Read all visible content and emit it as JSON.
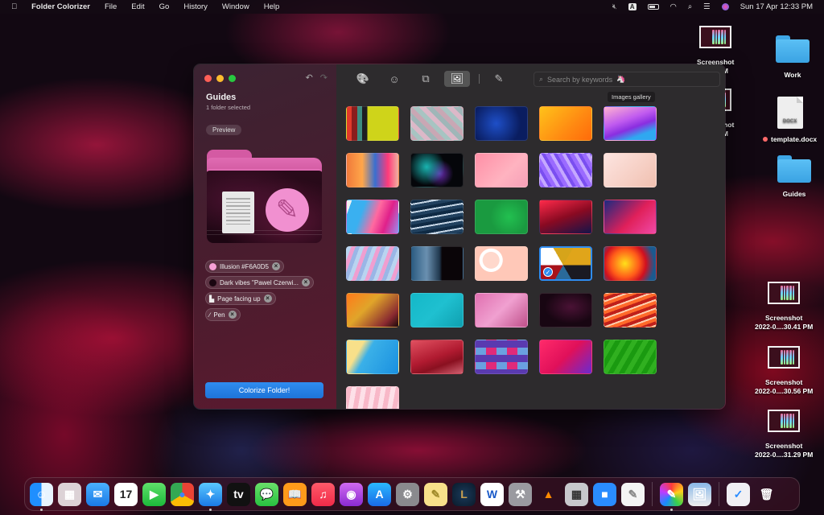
{
  "menubar": {
    "app_name": "Folder Colorizer",
    "menus": [
      "File",
      "Edit",
      "Go",
      "History",
      "Window",
      "Help"
    ],
    "input_source": "A",
    "datetime": "Sun 17 Apr  12:33 PM",
    "status_icons": [
      "mute-icon",
      "input-source-icon",
      "battery-icon",
      "wifi-icon",
      "spotlight-icon",
      "control-center-icon",
      "siri-icon"
    ]
  },
  "desktop": {
    "items": [
      {
        "label1": "Screenshot",
        "label2": "...10 PM",
        "kind": "screenshot"
      },
      {
        "label1": "Screenshot",
        "label2": "...31 PM",
        "kind": "screenshot"
      },
      {
        "label1": "Work",
        "kind": "folder"
      },
      {
        "label1": "template.docx",
        "kind": "docx",
        "file_type": "DOCX",
        "tag_color": "#FF6A6A"
      },
      {
        "label1": "Guides",
        "kind": "folder"
      },
      {
        "label1": "Screenshot",
        "label2": "2022-0....30.41 PM",
        "kind": "screenshot"
      },
      {
        "label1": "Screenshot",
        "label2": "2022-0....30.56 PM",
        "kind": "screenshot"
      },
      {
        "label1": "Screenshot",
        "label2": "2022-0....31.29 PM",
        "kind": "screenshot"
      }
    ]
  },
  "sidebar": {
    "folder_name": "Guides",
    "subtitle": "1 folder selected",
    "preview_label": "Preview",
    "chips": [
      {
        "label": "Illusion #F6A0D5",
        "swatch": "#F6A0D5",
        "icon": "color-swatch-icon"
      },
      {
        "label": "Dark vibes \"Pawel Czerwi...",
        "swatch": "#2a0a18",
        "icon": "image-swatch-icon"
      },
      {
        "label": "Page facing up",
        "icon": "page-icon"
      },
      {
        "label": "Pen",
        "icon": "pen-icon"
      }
    ],
    "colorize_button": "Colorize Folder!"
  },
  "toolbar": {
    "tabs": [
      {
        "name": "palette",
        "glyph": "🎨"
      },
      {
        "name": "emoji",
        "glyph": "☺"
      },
      {
        "name": "shapes",
        "glyph": "⧉"
      },
      {
        "name": "images-gallery",
        "glyph": "🖼"
      },
      {
        "name": "picker",
        "glyph": "✎"
      }
    ],
    "active_tab": "images-gallery",
    "tooltip": "Images gallery",
    "search_placeholder": "Search by keywords",
    "search_emoji": "🦄"
  },
  "gallery": {
    "selected_index": 18,
    "tiles": [
      "linear-gradient(90deg,#e23a2a 0 9%,#8a1d1d 9% 20%,#3e8c80 20% 30%,#1d1d22 30% 40%,#cfd41a 40%)",
      "repeating-linear-gradient(45deg,#c9a7b4 0 6px,#a7c4c2 6px 12px,#dcb8c8 12px 18px,#9fb6b8 18px 24px)",
      "radial-gradient(circle at 40% 50%,#1e4fc8,#0a1d60 70%)",
      "linear-gradient(135deg,#ffc21a,#ff8a12 60%,#ff6a0a)",
      "linear-gradient(160deg,#ffb3d0 0,#c05bef 40%,#8a2ee0 60%,#2fa8f0 80%)",
      "linear-gradient(90deg,#f07a3a,#ffa64a 30%,#3a6fd0 55%,#ff3a7a 80%,#f0b0a0)",
      "radial-gradient(circle at 30% 40%,#19b3b0,transparent 45%),radial-gradient(circle at 55% 60%,#6a2ab0,transparent 40%),#05060a",
      "linear-gradient(135deg,#ff8fa6,#ffb3c0 60%,#f6a0b8)",
      "repeating-linear-gradient(60deg,#9b6bff 0 5px,#c5a8ff 5px 9px,#7a4ef0 9px 13px)",
      "linear-gradient(135deg,#fde4e0,#f6cfc4 60%,#f0c0b0)",
      "linear-gradient(110deg,#f0f0f0 0 8%,#3ab0f0 8% 30%,#ff6aa0 55%,#e0208a 75%,#9b8ef0)",
      "repeating-linear-gradient(170deg,#0f2a44 0 4px,#c6d6e6 4px 6px,#21415f 6px 10px)",
      "radial-gradient(circle at 65% 50%,#22c050,#1a9a40 50%),linear-gradient(90deg,#e0b040,#1aa050)",
      "linear-gradient(160deg,#ff2a4a,#8a0a22 50%,#14144a)",
      "linear-gradient(135deg,#1a2a80,#e0205a 55%,#f04aa8)",
      "repeating-linear-gradient(110deg,#b9d4f0 0 5px,#f09ed0 5px 10px,#9ab6e6 10px 15px)",
      "linear-gradient(90deg,#2a5a80 0,#6a90b0 30%,#20384e 55%,#0a0508 60%)",
      "radial-gradient(circle at 30% 40%,#ffd8cc 0 20%,#fff 21% 28%,#ffc8b8 29%),#fff0ea",
      "conic-gradient(from 30deg at 45% 55%,#e0a51a 0 60deg,#1a1a22 60deg 120deg,#2a6a9a 120deg 180deg,#a8121a 180deg 240deg,#fff 240deg 300deg,#d6a41a 300deg)",
      "radial-gradient(circle at 40% 50%,#ffe01a,#ff5a1a 40%,#d01020 60%,#1a5a90 85%)",
      "linear-gradient(135deg,#ff7a1a,#e0a52a 40%,#8a2a30 80%,#1a0a0a)",
      "linear-gradient(135deg,#14b8c8,#1fc0d0 50%,#0fa0b0)",
      "linear-gradient(135deg,#e070b0,#f0a0d0 50%,#c0508a)",
      "radial-gradient(ellipse at 60% 40%,#4a1235,transparent 60%),#180612",
      "repeating-linear-gradient(160deg,#ff6a2a 0 4px,#c0201a 4px 8px,#ffd0b0 8px 10px)",
      "linear-gradient(120deg,#f8e08a 0 25%,#3ab0e8 40%,#1a90e0)",
      "linear-gradient(160deg,#e05060,#b01a30 50%,#8a1020 70%,#d06070)",
      "repeating-conic-gradient(#5a3ab0 0 25%,#e02a7a 0 50%,#6aa0e0 0 75%,#8a8a9a 0) 0 0/26px 18px",
      "linear-gradient(135deg,#ff2a6a,#e0105a 50%,#6a2ad0)",
      "repeating-linear-gradient(120deg,#1a9a10 0 6px,#30b020 6px 12px)",
      "repeating-linear-gradient(100deg,#f8b8c8 0 6px,#fde0e8 6px 12px)"
    ]
  },
  "dock": {
    "apps": [
      {
        "name": "finder",
        "bg": "linear-gradient(90deg,#1f8fff 50%,#e8f4ff 50%)",
        "glyph": "☺",
        "running": true
      },
      {
        "name": "launchpad",
        "bg": "#dcd2d6",
        "glyph": "▦",
        "running": false
      },
      {
        "name": "mail",
        "bg": "linear-gradient(#4ab0ff,#1a7ae6)",
        "glyph": "✉",
        "running": false
      },
      {
        "name": "calendar",
        "bg": "#ffffff",
        "glyph": "17",
        "glyph_color": "#222",
        "running": false
      },
      {
        "name": "facetime",
        "bg": "linear-gradient(#5fe06a,#1cb83a)",
        "glyph": "▶",
        "running": false
      },
      {
        "name": "chrome",
        "bg": "conic-gradient(#ea4335 0 33%,#fbbc05 0 66%,#34a853 0)",
        "glyph": "●",
        "glyph_color": "#4285f4",
        "running": false
      },
      {
        "name": "safari",
        "bg": "linear-gradient(#5ac8ff,#1a7ae6)",
        "glyph": "✦",
        "running": true
      },
      {
        "name": "apple-tv",
        "bg": "#111",
        "glyph": "tv",
        "running": false
      },
      {
        "name": "messages",
        "bg": "linear-gradient(#6ae06a,#28c040)",
        "glyph": "💬",
        "running": false
      },
      {
        "name": "books",
        "bg": "#ff9a1a",
        "glyph": "📖",
        "running": false
      },
      {
        "name": "music",
        "bg": "linear-gradient(#ff5a6a,#f02a48)",
        "glyph": "♫",
        "running": false
      },
      {
        "name": "podcasts",
        "bg": "linear-gradient(#d06af0,#8a2ad0)",
        "glyph": "◉",
        "running": false
      },
      {
        "name": "app-store",
        "bg": "linear-gradient(#2ab8ff,#1a6ae6)",
        "glyph": "A",
        "running": false
      },
      {
        "name": "system-preferences",
        "bg": "#8a8a8e",
        "glyph": "⚙",
        "running": false
      },
      {
        "name": "notes",
        "bg": "#f8e08a",
        "glyph": "✎",
        "glyph_color": "#a08a2a",
        "running": false
      },
      {
        "name": "league-of-legends",
        "bg": "radial-gradient(#1a3a5a,#0a1a2a)",
        "glyph": "L",
        "glyph_color": "#c8a050",
        "running": false
      },
      {
        "name": "microsoft-word",
        "bg": "#ffffff",
        "glyph": "W",
        "glyph_color": "#1a5ac8",
        "running": false
      },
      {
        "name": "git-tool",
        "bg": "#9a9aa0",
        "glyph": "⚒",
        "running": false
      },
      {
        "name": "vlc",
        "bg": "transparent",
        "glyph": "▲",
        "glyph_color": "#ff8a00",
        "running": false
      },
      {
        "name": "calculator",
        "bg": "#c8c8cc",
        "glyph": "▦",
        "glyph_color": "#333",
        "running": false
      },
      {
        "name": "zoom",
        "bg": "#2a8cff",
        "glyph": "■",
        "running": false
      },
      {
        "name": "textedit",
        "bg": "#f4f4f4",
        "glyph": "✎",
        "glyph_color": "#888",
        "running": false
      },
      {
        "name": "folder-colorizer",
        "bg": "conic-gradient(#ff3a3a,#ffd01a,#3ad04a,#1a8aff,#c03aff,#ff3a3a)",
        "glyph": "✎",
        "running": true
      },
      {
        "name": "preview",
        "bg": "linear-gradient(#8ab8e8,#eee)",
        "glyph": "🖼",
        "running": false
      },
      {
        "name": "downloads-stack",
        "bg": "#f0f0f4",
        "glyph": "✓",
        "glyph_color": "#2a8cff",
        "running": false
      },
      {
        "name": "trash",
        "bg": "transparent",
        "glyph": "🗑",
        "running": false
      }
    ]
  }
}
